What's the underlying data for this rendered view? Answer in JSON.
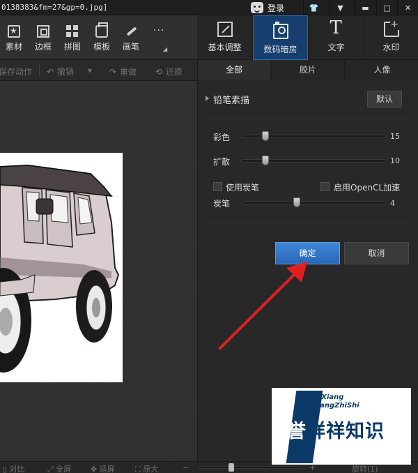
{
  "titlebar": {
    "filename": "0138383&fm=27&gp=0.jpg]",
    "login_label": "登录",
    "buttons": [
      "▲",
      "▼",
      "□",
      "✕"
    ]
  },
  "toolbar": {
    "items": [
      {
        "label": "素材",
        "icon": "material-icon"
      },
      {
        "label": "边框",
        "icon": "frame-icon"
      },
      {
        "label": "拼图",
        "icon": "collage-icon"
      },
      {
        "label": "模板",
        "icon": "template-icon"
      },
      {
        "label": "画笔",
        "icon": "brush-icon"
      }
    ],
    "more": "···"
  },
  "main_tabs": [
    {
      "label": "基本调整",
      "icon": "adjust-icon"
    },
    {
      "label": "数码暗房",
      "icon": "camera-icon",
      "active": true
    },
    {
      "label": "文字",
      "icon": "text-icon"
    },
    {
      "label": "水印",
      "icon": "watermark-icon"
    }
  ],
  "action_bar": {
    "save_action": "保存动作",
    "undo": "撤销",
    "redo": "重做",
    "restore": "还原"
  },
  "sub_tabs": [
    {
      "label": "全部",
      "active": true
    },
    {
      "label": "胶片"
    },
    {
      "label": "人像"
    }
  ],
  "effect": {
    "title": "铅笔素描",
    "default_button": "默认",
    "sliders": [
      {
        "label": "彩色",
        "value": "15",
        "fraction": 0.15
      },
      {
        "label": "扩散",
        "value": "10",
        "fraction": 0.15
      },
      {
        "label": "炭笔",
        "value": "4",
        "fraction": 0.37
      }
    ],
    "checkboxes": [
      {
        "label": "使用炭笔",
        "checked": false
      },
      {
        "label": "启用OpenCL加速",
        "checked": false
      }
    ],
    "ok_button": "确定",
    "cancel_button": "取消"
  },
  "statusbar": {
    "compare": "对比",
    "fullscreen": "全屏",
    "fit": "适屏",
    "original": "原大",
    "minus": "−",
    "plus": "+",
    "rotate": "旋转(1)",
    "zoom_fraction": 0.3
  },
  "watermark": {
    "line1": "YuXiang",
    "line2": "XiangZhiShi",
    "char1": "誉",
    "rest": "祥祥知识"
  },
  "colors": {
    "accent_blue": "#2a68b8",
    "active_tab": "#163e6e",
    "arrow_red": "#e02020",
    "watermark_navy": "#0b3a68"
  }
}
